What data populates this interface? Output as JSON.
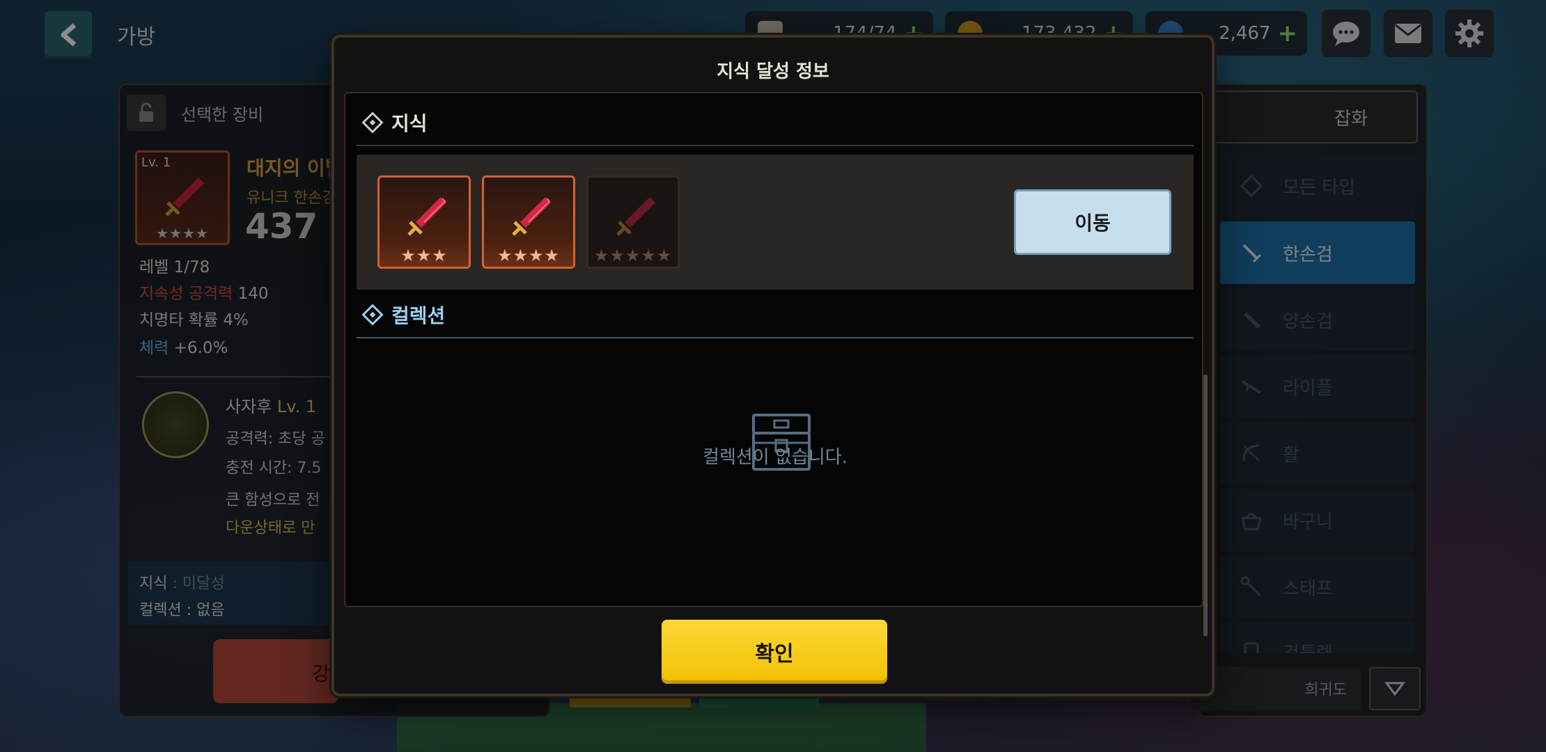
{
  "topbar": {
    "title": "가방",
    "resource1": "174/74",
    "resource2": "173,432",
    "resource3": "2,467",
    "plus": "+"
  },
  "left_panel": {
    "header": "선택한 장비",
    "item_level": "Lv. 1",
    "item_stars": "★★★★",
    "item_name": "대지의 이별",
    "item_type": "유니크 한손검",
    "item_power": "437",
    "level_line": "레벨 1/78",
    "stat1_key": "지속성 공격력",
    "stat1_val": "140",
    "stat2": "치명타 확률 4%",
    "stat3_key": "체력",
    "stat3_val": "+6.0%",
    "skill_name": "사자후",
    "skill_lv": "Lv. 1",
    "skill_line1": "공격력: 초당 공",
    "skill_line2": "충전 시간: 7.5",
    "skill_line3": "큰 함성으로 전",
    "skill_line4": "다운상태로 만",
    "knowledge_key": "지식",
    "knowledge_val": ": 미달성",
    "collection_line": "컬렉션 : 없음",
    "enhance_label": "강"
  },
  "right_panel": {
    "tab_misc": "잡화",
    "categories": [
      {
        "label": "모든 타입",
        "icon": "all-types-icon"
      },
      {
        "label": "한손검",
        "icon": "one-hand-sword-icon"
      },
      {
        "label": "양손검",
        "icon": "two-hand-sword-icon"
      },
      {
        "label": "라이플",
        "icon": "rifle-icon"
      },
      {
        "label": "활",
        "icon": "bow-icon"
      },
      {
        "label": "바구니",
        "icon": "basket-icon"
      },
      {
        "label": "스태프",
        "icon": "staff-icon"
      },
      {
        "label": "건틀렛",
        "icon": "gauntlet-icon"
      }
    ],
    "sort_label": "희귀도"
  },
  "modal": {
    "title": "지식 달성 정보",
    "knowledge_section": "지식",
    "collection_section": "컬렉션",
    "cards": [
      {
        "stars": "★★★",
        "state": "active"
      },
      {
        "stars": "★★★★",
        "state": "active"
      },
      {
        "stars": "★★★★★",
        "state": "locked"
      }
    ],
    "move_button": "이동",
    "empty_message": "컬렉션이 없습니다.",
    "confirm_button": "확인"
  },
  "colors": {
    "confirm": "#f7cc14",
    "active_tab": "#1e6fa8",
    "card_border": "#d2632e"
  }
}
